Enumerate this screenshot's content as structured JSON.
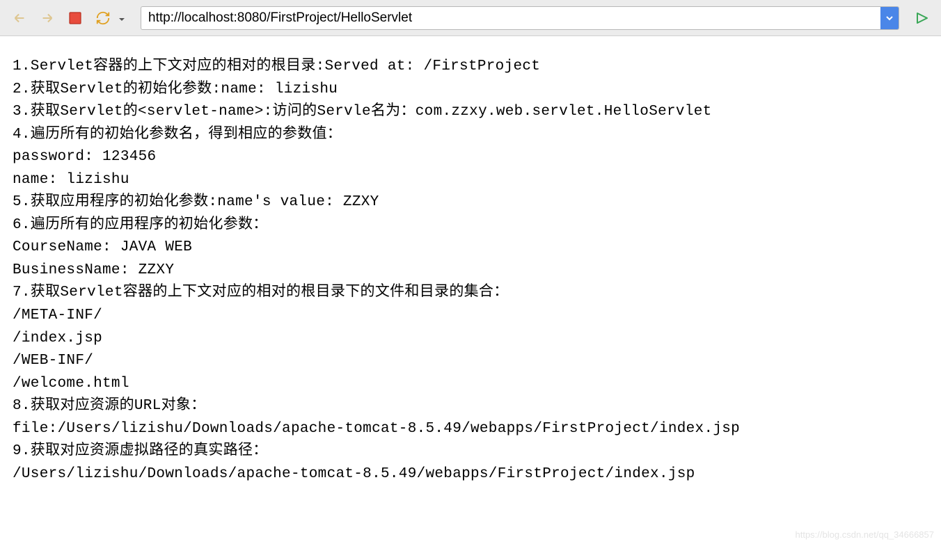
{
  "toolbar": {
    "url": "http://localhost:8080/FirstProject/HelloServlet"
  },
  "content": {
    "lines": [
      "1.Servlet容器的上下文对应的相对的根目录:Served at: /FirstProject",
      "2.获取Servlet的初始化参数:name: lizishu",
      "3.获取Servlet的<servlet-name>:访问的Servle名为：com.zzxy.web.servlet.HelloServlet",
      "4.遍历所有的初始化参数名，得到相应的参数值：",
      "password: 123456",
      "name: lizishu",
      "5.获取应用程序的初始化参数:name's value: ZZXY",
      "6.遍历所有的应用程序的初始化参数：",
      "CourseName: JAVA WEB",
      "BusinessName: ZZXY",
      "7.获取Servlet容器的上下文对应的相对的根目录下的文件和目录的集合：",
      "/META-INF/",
      "/index.jsp",
      "/WEB-INF/",
      "/welcome.html",
      "8.获取对应资源的URL对象：",
      "file:/Users/lizishu/Downloads/apache-tomcat-8.5.49/webapps/FirstProject/index.jsp",
      "9.获取对应资源虚拟路径的真实路径：",
      "/Users/lizishu/Downloads/apache-tomcat-8.5.49/webapps/FirstProject/index.jsp"
    ]
  },
  "watermark": "https://blog.csdn.net/qq_34666857"
}
